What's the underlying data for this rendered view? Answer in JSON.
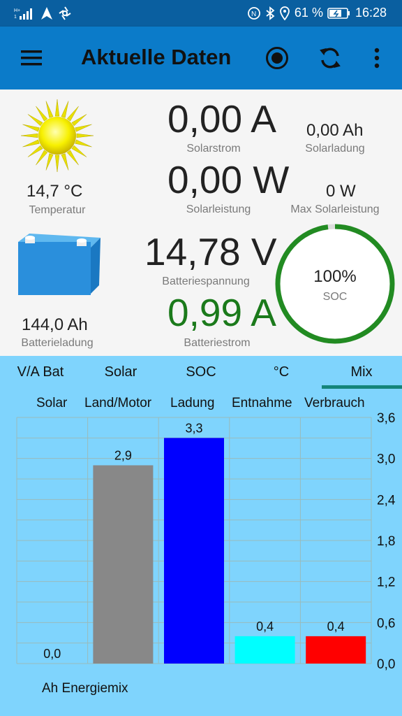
{
  "status_bar": {
    "battery_percent": "61 %",
    "time": "16:28"
  },
  "app_bar": {
    "title": "Aktuelle Daten"
  },
  "panel": {
    "temperature": {
      "value": "14,7 °C",
      "label": "Temperatur"
    },
    "battery_charge": {
      "value": "144,0 Ah",
      "label": "Batterieladung"
    },
    "solar_current": {
      "value": "0,00 A",
      "label": "Solarstrom"
    },
    "solar_charge": {
      "value": "0,00 Ah",
      "label": "Solarladung"
    },
    "solar_power": {
      "value": "0,00 W",
      "label": "Solarleistung"
    },
    "max_solar_power": {
      "value": "0 W",
      "label": "Max Solarleistung"
    },
    "battery_voltage": {
      "value": "14,78 V",
      "label": "Batteriespannung"
    },
    "battery_current": {
      "value": "0,99 A",
      "label": "Batteriestrom"
    },
    "soc": {
      "value": "100%",
      "label": "SOC",
      "fraction": 0.98
    }
  },
  "tabs": [
    {
      "label": "V/A Bat"
    },
    {
      "label": "Solar"
    },
    {
      "label": "SOC"
    },
    {
      "label": "°C"
    },
    {
      "label": "Mix",
      "selected": true
    }
  ],
  "chart_data": {
    "type": "bar",
    "categories": [
      "Solar",
      "Land/Motor",
      "Ladung",
      "Entnahme",
      "Verbrauch"
    ],
    "values": [
      0.0,
      2.9,
      3.3,
      0.4,
      0.4
    ],
    "value_labels": [
      "0,0",
      "2,9",
      "3,3",
      "0,4",
      "0,4"
    ],
    "colors": [
      "#7fd4fd",
      "#888888",
      "#0000ff",
      "#00ffff",
      "#ff0000"
    ],
    "ylim": [
      0,
      3.6
    ],
    "yticks": [
      "0,0",
      "0,6",
      "1,2",
      "1,8",
      "2,4",
      "3,0",
      "3,6"
    ],
    "grid": true,
    "legend_position": "top",
    "xlabel": "Ah Energiemix"
  },
  "colors": {
    "app_bar": "#0b7bc9",
    "status_bar": "#0a5fa0",
    "chart_bg": "#7fd4fd",
    "battery_current": "#1b7a1b",
    "soc_ring": "#228b22",
    "tab_indicator": "#14857a"
  }
}
